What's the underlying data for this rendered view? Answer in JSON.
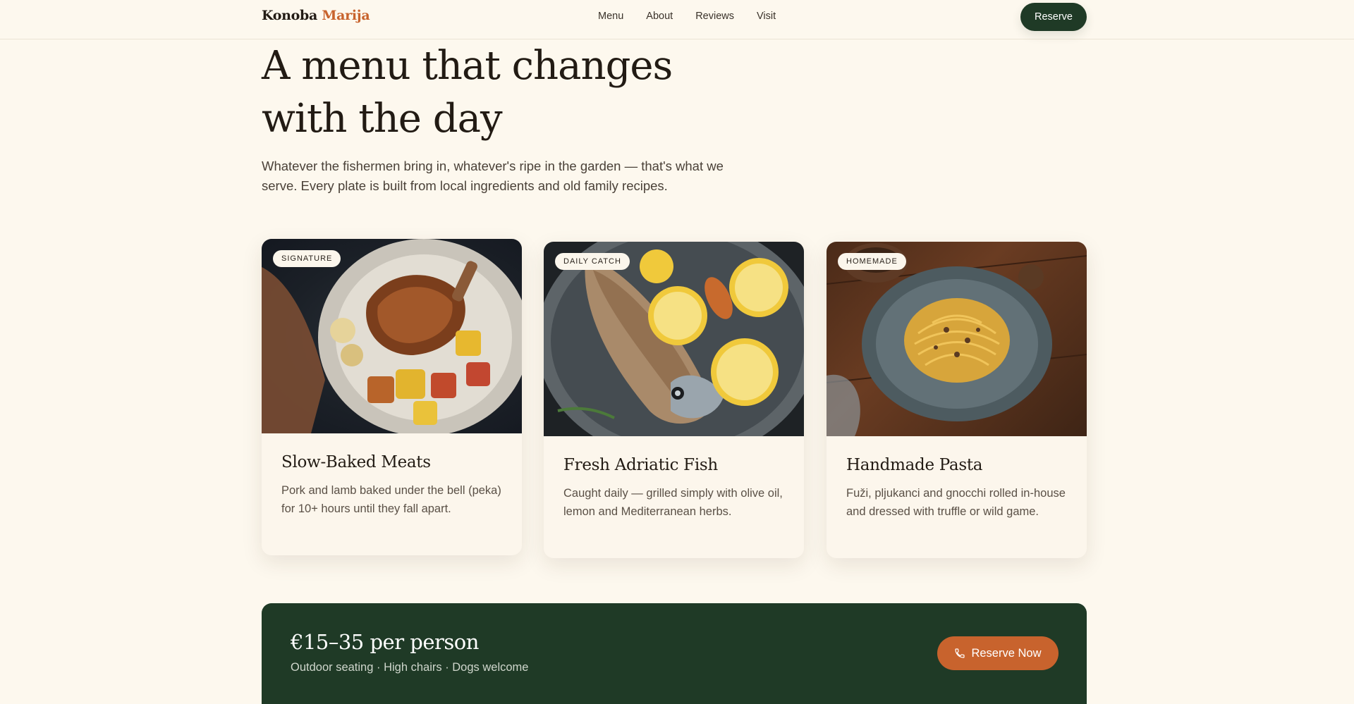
{
  "nav": {
    "logo_main": "Konoba",
    "logo_accent": "Marija",
    "links": [
      "Menu",
      "About",
      "Reviews",
      "Visit"
    ],
    "reserve": "Reserve"
  },
  "hero": {
    "title": "A menu that changes with the day",
    "subtitle": "Whatever the fishermen bring in, whatever's ripe in the garden — that's what we serve. Every plate is built from local ingredients and old family recipes."
  },
  "cards": [
    {
      "badge": "SIGNATURE",
      "title": "Slow-Baked Meats",
      "text": "Pork and lamb baked under the bell (peka) for 10+ hours until they fall apart.",
      "image_icon": "roast-meat-plate-image"
    },
    {
      "badge": "DAILY CATCH",
      "title": "Fresh Adriatic Fish",
      "text": "Caught daily — grilled simply with olive oil, lemon and Mediterranean herbs.",
      "image_icon": "grilled-fish-plate-image"
    },
    {
      "badge": "HOMEMADE",
      "title": "Handmade Pasta",
      "text": "Fuži, pljukanci and gnocchi rolled in-house and dressed with truffle or wild game.",
      "image_icon": "pasta-bowl-image"
    }
  ],
  "cta": {
    "price": "€15–35 per person",
    "info": "Outdoor seating · High chairs · Dogs welcome",
    "button": "Reserve Now",
    "button_icon": "phone-icon"
  },
  "colors": {
    "background": "#fdf8ee",
    "dark_green": "#1f3a26",
    "accent_orange": "#c8632d"
  }
}
